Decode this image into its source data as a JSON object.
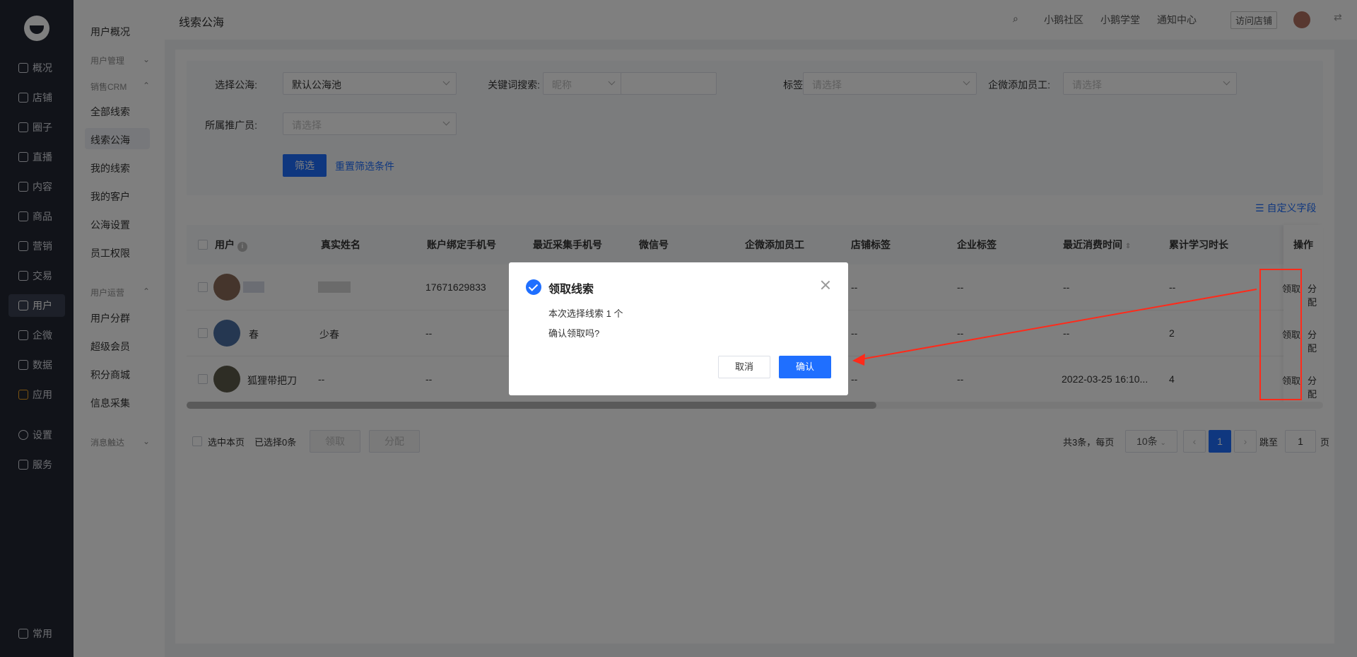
{
  "sidebar": {
    "items": [
      {
        "label": "概况",
        "icon": "dashboard-icon"
      },
      {
        "label": "店铺",
        "icon": "store-icon"
      },
      {
        "label": "圈子",
        "icon": "circle-icon"
      },
      {
        "label": "直播",
        "icon": "live-icon"
      },
      {
        "label": "内容",
        "icon": "content-icon"
      },
      {
        "label": "商品",
        "icon": "goods-icon"
      },
      {
        "label": "营销",
        "icon": "marketing-icon"
      },
      {
        "label": "交易",
        "icon": "trade-icon"
      },
      {
        "label": "用户",
        "icon": "user-icon"
      },
      {
        "label": "企微",
        "icon": "wecom-icon"
      },
      {
        "label": "数据",
        "icon": "data-icon"
      },
      {
        "label": "应用",
        "icon": "apps-icon"
      },
      {
        "label": "设置",
        "icon": "settings-icon"
      },
      {
        "label": "服务",
        "icon": "service-icon"
      }
    ],
    "bottom": {
      "label": "常用",
      "icon": "list-icon"
    }
  },
  "subnav": {
    "overview": "用户概况",
    "user_manage": "用户管理",
    "crm_group": "销售CRM",
    "crm_items": [
      "全部线索",
      "线索公海",
      "我的线索",
      "我的客户",
      "公海设置",
      "员工权限"
    ],
    "ops_group": "用户运营",
    "ops_items": [
      "用户分群",
      "超级会员",
      "积分商城",
      "信息采集"
    ],
    "msg_group": "消息触达"
  },
  "topbar": {
    "title": "线索公海",
    "links": [
      "小鹅社区",
      "小鹅学堂",
      "通知中心"
    ],
    "visit_store": "访问店铺"
  },
  "filter": {
    "pool_label": "选择公海:",
    "pool_value": "默认公海池",
    "keyword_label": "关键词搜索:",
    "keyword_type": "昵称",
    "tag_label": "标签:",
    "tag_placeholder": "请选择",
    "staff_label": "企微添加员工:",
    "staff_placeholder": "请选择",
    "promoter_label": "所属推广员:",
    "promoter_placeholder": "请选择",
    "filter_button": "筛选",
    "reset_link": "重置筛选条件"
  },
  "custom_fields": "自定义字段",
  "table": {
    "headers": [
      "用户",
      "真实姓名",
      "账户绑定手机号",
      "最近采集手机号",
      "微信号",
      "企微添加员工",
      "店铺标签",
      "企业标签",
      "最近消费时间",
      "累计学习时长",
      "操作"
    ],
    "rows": [
      {
        "user": "",
        "real_name": "",
        "phone": "17671629833",
        "phone2": "",
        "wechat": "",
        "staff": "",
        "store_tag": "--",
        "corp_tag": "--",
        "last_spend": "--",
        "study": "--",
        "claim": "领取",
        "assign": "分配"
      },
      {
        "user": "春",
        "real_name": "少春",
        "phone": "--",
        "phone2": "",
        "wechat": "",
        "staff": "",
        "store_tag": "--",
        "corp_tag": "--",
        "last_spend": "--",
        "study": "2",
        "claim": "领取",
        "assign": "分配"
      },
      {
        "user": "狐狸带把刀",
        "real_name": "--",
        "phone": "--",
        "phone2": "",
        "wechat": "",
        "staff": "",
        "store_tag": "--",
        "corp_tag": "--",
        "last_spend": "2022-03-25 16:10...",
        "study": "4",
        "claim": "领取",
        "assign": "分配"
      }
    ]
  },
  "footer": {
    "select_page": "选中本页",
    "selected": "已选择0条",
    "claim": "领取",
    "assign": "分配",
    "total": "共3条，每页",
    "page_size": "10条",
    "current_page": "1",
    "jump_to": "跳至",
    "jump_value": "1",
    "page_unit": "页"
  },
  "dialog": {
    "title": "领取线索",
    "line1": "本次选择线索 1 个",
    "line2": "确认领取吗?",
    "cancel": "取消",
    "confirm": "确认"
  },
  "colors": {
    "accent": "#1f6fff",
    "annotation": "#ff2a1a",
    "sidebar_bg": "#222632"
  }
}
